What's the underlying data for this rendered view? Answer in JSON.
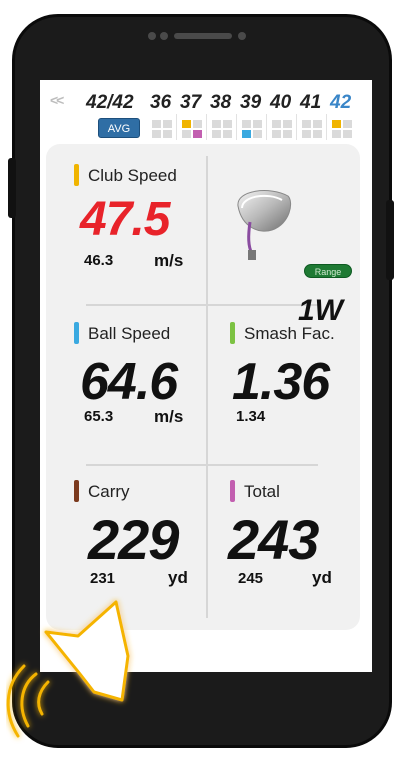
{
  "shots": {
    "back_label": "<<",
    "count_label": "42/42",
    "avg_label": "AVG",
    "numbers": [
      "36",
      "37",
      "38",
      "39",
      "40",
      "41",
      "42"
    ],
    "selected": "42"
  },
  "club": {
    "mode_badge": "Range",
    "name": "1W"
  },
  "metrics": {
    "club_speed": {
      "label": "Club Speed",
      "value": "47.5",
      "sub": "46.3",
      "unit": "m/s",
      "accent": "#f0b400",
      "value_color": "#e8232a"
    },
    "ball_speed": {
      "label": "Ball Speed",
      "value": "64.6",
      "sub": "65.3",
      "unit": "m/s",
      "accent": "#3aa9e0"
    },
    "smash": {
      "label": "Smash Fac.",
      "value": "1.36",
      "sub": "1.34",
      "accent": "#7cc242"
    },
    "carry": {
      "label": "Carry",
      "value": "229",
      "sub": "231",
      "unit": "yd",
      "accent": "#7b3a1e"
    },
    "total": {
      "label": "Total",
      "value": "243",
      "sub": "245",
      "unit": "yd",
      "accent": "#c25fb0"
    }
  },
  "icons": {
    "sound": "speaker-sound-icon",
    "club": "driver-club-icon"
  },
  "colors": {
    "selected_shot": "#3a86c8",
    "avg_badge": "#2f6ea5",
    "range_badge": "#1f7a34",
    "glow": "#f5b400"
  }
}
